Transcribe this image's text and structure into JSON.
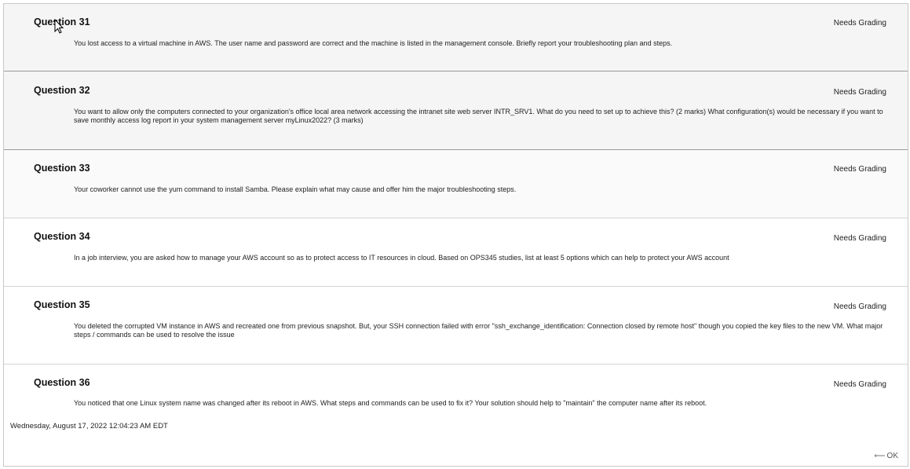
{
  "questions": [
    {
      "title": "Question 31",
      "status": "Needs Grading",
      "text": "You lost access to a virtual machine in AWS. The user name and password are correct and the machine is listed in the management console. Briefly report your troubleshooting plan and steps."
    },
    {
      "title": "Question 32",
      "status": "Needs Grading",
      "text": "You want to allow only the computers connected to your organization's office local area network accessing the intranet site web server INTR_SRV1. What do you need to set up to achieve this? (2 marks) What configuration(s) would be necessary if you want to save monthly access log report in your system management server myLinux2022? (3 marks)"
    },
    {
      "title": "Question 33",
      "status": "Needs Grading",
      "text": "Your coworker cannot use the yum command to install Samba. Please explain what may cause and offer him the major troubleshooting steps."
    },
    {
      "title": "Question 34",
      "status": "Needs Grading",
      "text": "In a job interview, you are asked how to manage your AWS account so as to protect access to IT resources in cloud. Based on OPS345 studies, list at least 5 options which can help to protect your AWS account"
    },
    {
      "title": "Question 35",
      "status": "Needs Grading",
      "text": "You deleted the corrupted VM instance in AWS and recreated one from previous snapshot. But, your SSH connection failed with error \"ssh_exchange_identification: Connection closed by remote host\" though you copied the key files to the new VM. What major steps / commands can be used to resolve the issue"
    },
    {
      "title": "Question 36",
      "status": "Needs Grading",
      "text": "You noticed that one Linux system name was changed after its reboot in AWS. What steps and commands can be used to fix it? Your solution should help to \"maintain\" the computer name after its reboot."
    }
  ],
  "timestamp": "Wednesday, August 17, 2022 12:04:23 AM EDT",
  "ok_label": "OK",
  "icons": {
    "ok_arrow": "arrow-left-icon",
    "cursor": "mouse-cursor-icon"
  }
}
